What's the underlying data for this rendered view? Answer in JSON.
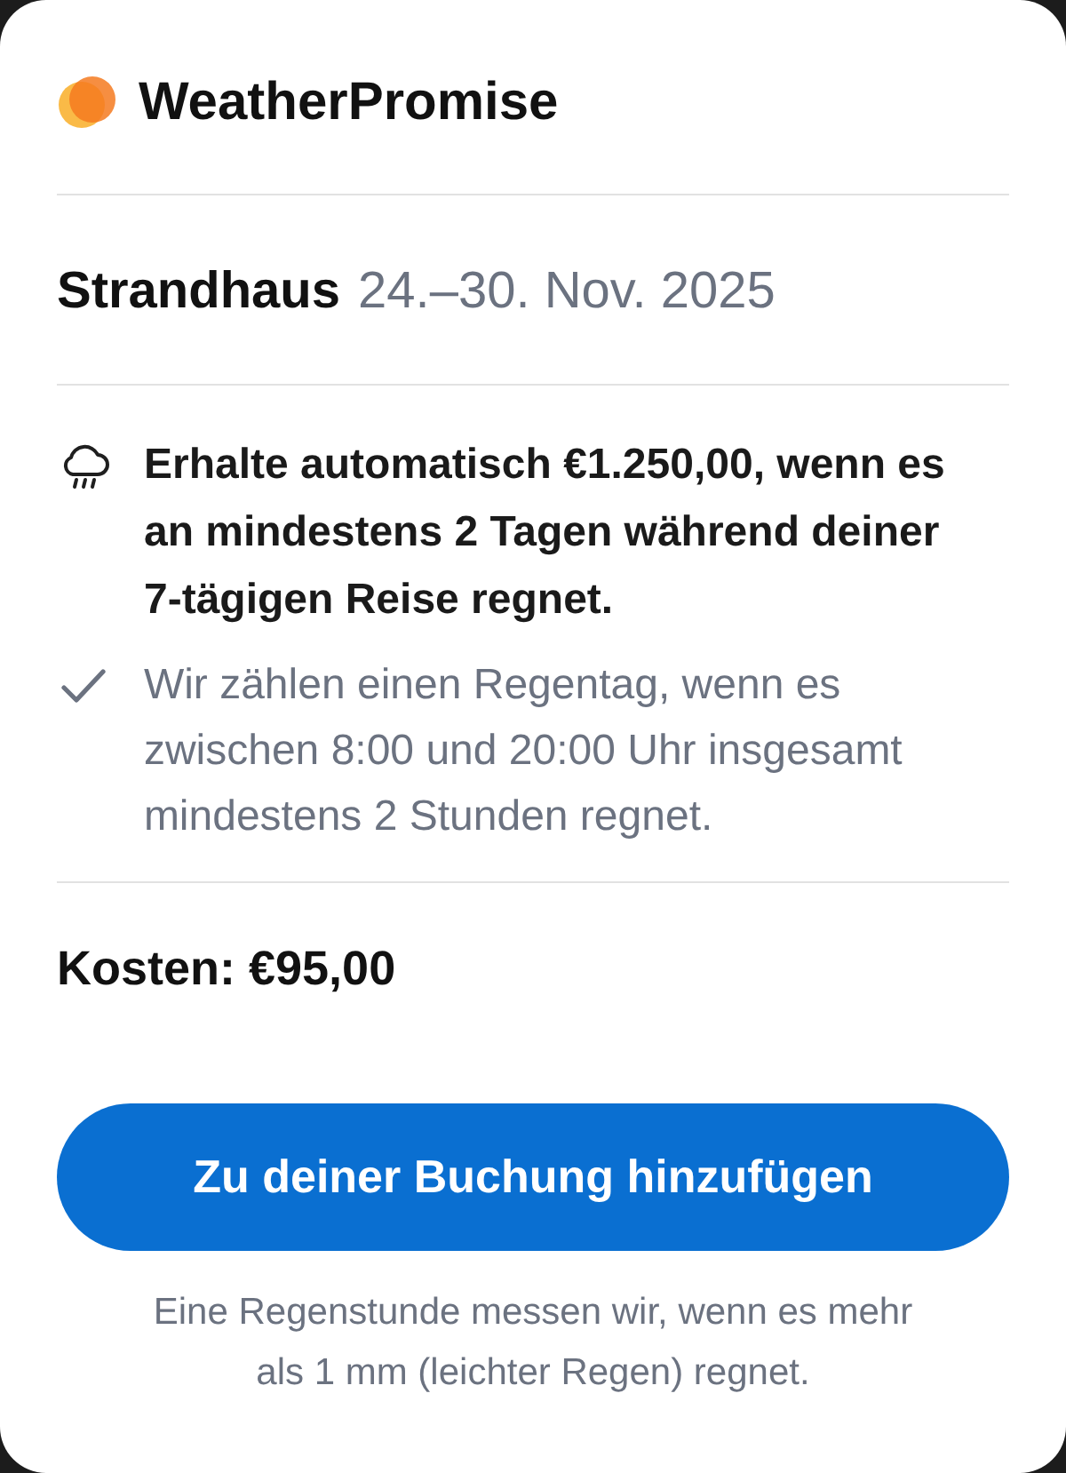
{
  "brand": {
    "name": "WeatherPromise"
  },
  "trip": {
    "name": "Strandhaus",
    "dates": "24.–30. Nov. 2025"
  },
  "benefits": [
    {
      "kind": "rain",
      "text": "Erhalte automatisch €1.250,00, wenn es an mindestens 2 Tagen während deiner 7-tägigen Reise regnet."
    },
    {
      "kind": "check",
      "text": "Wir zählen einen Regentag, wenn es zwischen 8:00 und 20:00 Uhr insgesamt mindestens 2 Stunden regnet."
    }
  ],
  "cost": "Kosten: €95,00",
  "button": {
    "label": "Zu deiner Buchung hinzufügen"
  },
  "footnote": "Eine Regenstunde messen wir, wenn es mehr als 1 mm (leichter Regen) regnet."
}
